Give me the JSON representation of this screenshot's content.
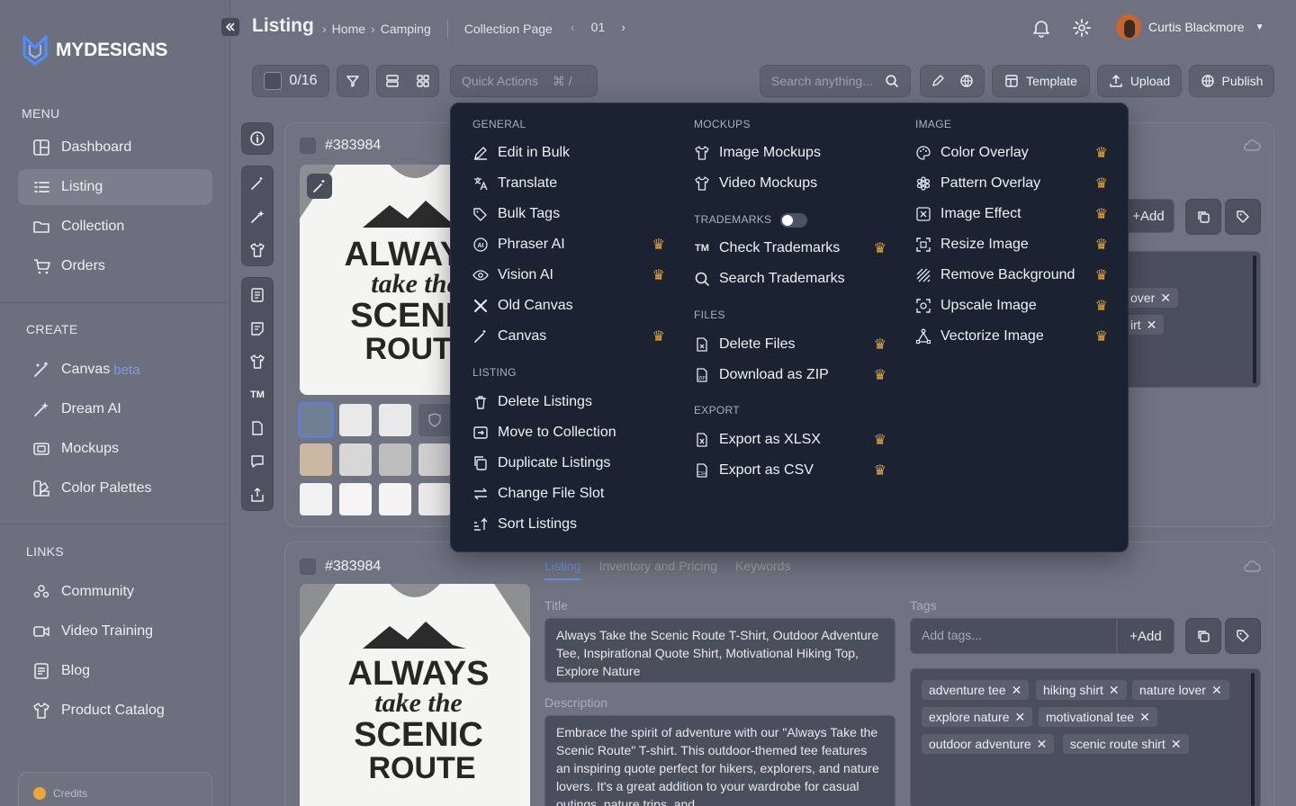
{
  "brand": {
    "name": "MYDESIGNS",
    "accent": "#4f8ef7"
  },
  "sidebar": {
    "menu_heading": "MENU",
    "menu": [
      {
        "label": "Dashboard",
        "icon": "dashboard-icon"
      },
      {
        "label": "Listing",
        "icon": "list-icon",
        "active": true
      },
      {
        "label": "Collection",
        "icon": "folder-icon"
      },
      {
        "label": "Orders",
        "icon": "cart-icon"
      }
    ],
    "create_heading": "CREATE",
    "create": [
      {
        "label": "Canvas",
        "badge": "beta",
        "icon": "magic-wand-icon"
      },
      {
        "label": "Dream AI",
        "icon": "sparkle-wand-icon"
      },
      {
        "label": "Mockups",
        "icon": "mockup-icon"
      },
      {
        "label": "Color Palettes",
        "icon": "palette-icon"
      }
    ],
    "links_heading": "LINKS",
    "links": [
      {
        "label": "Community",
        "icon": "community-icon"
      },
      {
        "label": "Video Training",
        "icon": "video-icon"
      },
      {
        "label": "Blog",
        "icon": "blog-icon"
      },
      {
        "label": "Product Catalog",
        "icon": "shirt-icon"
      }
    ],
    "credits_label": "Credits"
  },
  "header": {
    "title": "Listing",
    "breadcrumbs": [
      "Home",
      "Camping"
    ],
    "collection_label": "Collection Page",
    "page_number": "01",
    "user_name": "Curtis Blackmore"
  },
  "toolbar": {
    "selection_count": "0/16",
    "quick_actions_label": "Quick Actions",
    "quick_actions_shortcut": "⌘ /",
    "search_placeholder": "Search anything...",
    "template_label": "Template",
    "upload_label": "Upload",
    "publish_label": "Publish"
  },
  "quick_menu": {
    "general": {
      "heading": "GENERAL",
      "items": [
        {
          "label": "Edit in Bulk",
          "icon": "edit-icon",
          "premium": false
        },
        {
          "label": "Translate",
          "icon": "translate-icon",
          "premium": false
        },
        {
          "label": "Bulk Tags",
          "icon": "tag-icon",
          "premium": false
        },
        {
          "label": "Phraser AI",
          "icon": "ai-icon",
          "premium": true
        },
        {
          "label": "Vision AI",
          "icon": "eye-icon",
          "premium": true
        },
        {
          "label": "Old Canvas",
          "icon": "tools-icon",
          "premium": false
        },
        {
          "label": "Canvas",
          "icon": "magic-wand-icon",
          "premium": true
        }
      ]
    },
    "listing": {
      "heading": "LISTING",
      "items": [
        {
          "label": "Delete Listings",
          "icon": "trash-icon"
        },
        {
          "label": "Move to Collection",
          "icon": "move-icon"
        },
        {
          "label": "Duplicate Listings",
          "icon": "copy-icon"
        },
        {
          "label": "Change File Slot",
          "icon": "swap-icon"
        },
        {
          "label": "Sort Listings",
          "icon": "sort-icon"
        }
      ]
    },
    "mockups": {
      "heading": "MOCKUPS",
      "items": [
        {
          "label": "Image Mockups",
          "icon": "shirt-icon"
        },
        {
          "label": "Video Mockups",
          "icon": "shirt-icon"
        }
      ]
    },
    "trademarks": {
      "heading": "TRADEMARKS",
      "toggle_on": false,
      "items": [
        {
          "label": "Check Trademarks",
          "icon": "tm-icon",
          "premium": true
        },
        {
          "label": "Search Trademarks",
          "icon": "search-icon",
          "premium": false
        }
      ]
    },
    "files": {
      "heading": "FILES",
      "items": [
        {
          "label": "Delete Files",
          "icon": "file-delete-icon",
          "premium": true
        },
        {
          "label": "Download as ZIP",
          "icon": "zip-icon",
          "premium": true
        }
      ]
    },
    "export": {
      "heading": "EXPORT",
      "items": [
        {
          "label": "Export as XLSX",
          "icon": "xlsx-icon",
          "premium": true
        },
        {
          "label": "Export as CSV",
          "icon": "csv-icon",
          "premium": true
        }
      ]
    },
    "image": {
      "heading": "IMAGE",
      "items": [
        {
          "label": "Color Overlay",
          "icon": "palette-icon",
          "premium": true
        },
        {
          "label": "Pattern Overlay",
          "icon": "pattern-icon",
          "premium": true
        },
        {
          "label": "Image Effect",
          "icon": "image-effect-icon",
          "premium": true
        },
        {
          "label": "Resize Image",
          "icon": "resize-icon",
          "premium": true
        },
        {
          "label": "Remove Background",
          "icon": "remove-bg-icon",
          "premium": true
        },
        {
          "label": "Upscale Image",
          "icon": "upscale-icon",
          "premium": true
        },
        {
          "label": "Vectorize Image",
          "icon": "vector-icon",
          "premium": true
        }
      ]
    }
  },
  "cards": [
    {
      "id": "#383984",
      "partial_tags": [
        "over",
        "irt"
      ],
      "add_label": "+Add",
      "design_text": "ALWAYS take the SCENIC ROUTE"
    },
    {
      "id": "#383984",
      "tabs": [
        "Listing",
        "Inventory and Pricing",
        "Keywords"
      ],
      "title_label": "Title",
      "title_value": "Always Take the Scenic Route T-Shirt, Outdoor Adventure Tee, Inspirational Quote Shirt, Motivational Hiking Top, Explore Nature",
      "description_label": "Description",
      "description_value": "Embrace the spirit of adventure with our \"Always Take the Scenic Route\" T-shirt. This outdoor-themed tee features an inspiring quote perfect for hikers, explorers, and nature lovers. It's a great addition to your wardrobe for casual outings, nature trips, and",
      "tags_label": "Tags",
      "tags_placeholder": "Add tags...",
      "add_label": "+Add",
      "tags": [
        "adventure tee",
        "hiking shirt",
        "nature lover",
        "explore nature",
        "motivational tee",
        "outdoor adventure",
        "scenic route shirt"
      ],
      "design_text": "ALWAYS take the SCENIC ROUTE"
    }
  ],
  "colors": {
    "premium_crown": "#e8a83a",
    "menu_bg": "#1b2231",
    "tab_active": "#6e8fe8"
  }
}
